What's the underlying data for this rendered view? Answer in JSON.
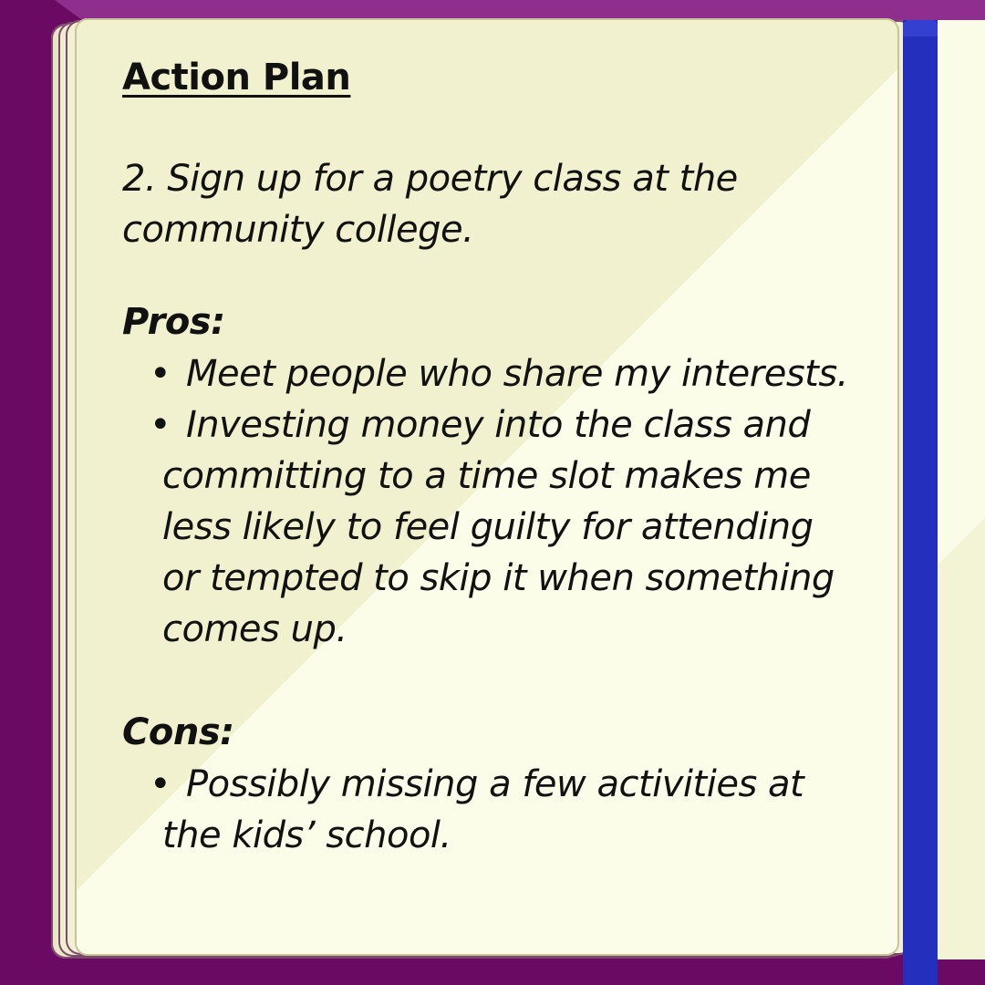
{
  "notebook": {
    "title": "Action Plan",
    "plan_item": "2.  Sign up for a poetry class at the community college.",
    "pros": {
      "heading": "Pros:",
      "items": [
        "Meet people who share my interests.",
        "Investing money into the class and committing to a time slot makes me less likely to feel guilty for attending or tempted to skip it when something comes up."
      ]
    },
    "cons": {
      "heading": "Cons:",
      "items": [
        "Possibly missing a few activities at the kids’ school."
      ]
    },
    "bullet": "•"
  },
  "colors": {
    "background": "#6b0a62",
    "cover_edge": "#8e2f8e",
    "page_shade": "#f1f1cf",
    "page_light": "#fcfde9",
    "bookmark": "#2430bd",
    "ink": "#111111"
  }
}
